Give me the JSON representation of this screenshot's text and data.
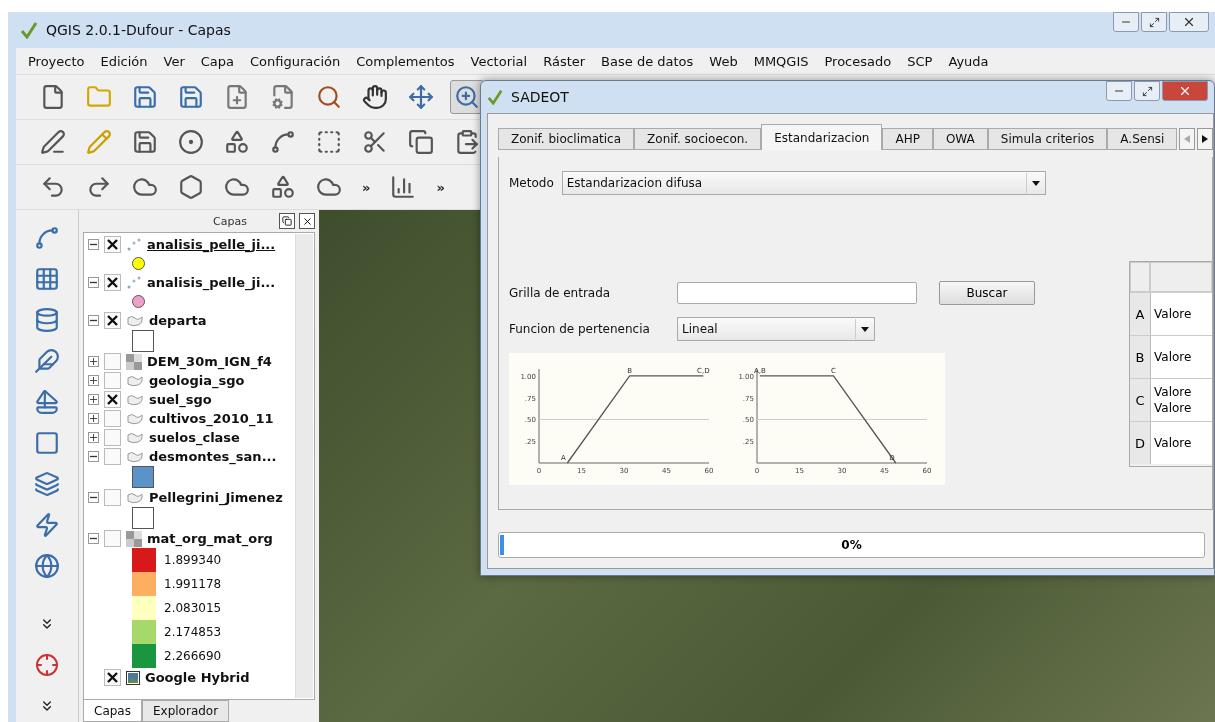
{
  "window": {
    "title": "QGIS 2.0.1-Dufour - Capas"
  },
  "menu": [
    "Proyecto",
    "Edición",
    "Ver",
    "Capa",
    "Configuración",
    "Complementos",
    "Vectorial",
    "Ráster",
    "Base de datos",
    "Web",
    "MMQGIS",
    "Procesado",
    "SCP",
    "Ayuda"
  ],
  "toolbar_overflow": [
    "»",
    "»"
  ],
  "layers_panel": {
    "title": "Capas",
    "layers": [
      {
        "name": "analisis_pelle_ji...",
        "kind": "points",
        "checked": true,
        "expanded": true,
        "selected": true,
        "children": [
          {
            "kind": "circle",
            "color": "#ffff00"
          }
        ]
      },
      {
        "name": "analisis_pelle_ji...",
        "kind": "points",
        "checked": true,
        "expanded": true,
        "selected": false,
        "children": [
          {
            "kind": "circle",
            "color": "#f0a0c8"
          }
        ]
      },
      {
        "name": "departa",
        "kind": "polygon",
        "checked": true,
        "expanded": true,
        "selected": false,
        "children": [
          {
            "kind": "square",
            "color": "#ffffff"
          }
        ]
      },
      {
        "name": "DEM_30m_IGN_f4",
        "kind": "raster",
        "checked": false,
        "expanded": false,
        "selected": false
      },
      {
        "name": "geologia_sgo",
        "kind": "polygon",
        "checked": false,
        "expanded": false,
        "selected": false
      },
      {
        "name": "suel_sgo",
        "kind": "polygon",
        "checked": true,
        "expanded": false,
        "selected": false
      },
      {
        "name": "cultivos_2010_11",
        "kind": "polygon",
        "checked": false,
        "expanded": false,
        "selected": false
      },
      {
        "name": "suelos_clase",
        "kind": "polygon",
        "checked": false,
        "expanded": false,
        "selected": false
      },
      {
        "name": "desmontes_san...",
        "kind": "polygon",
        "checked": false,
        "expanded": true,
        "selected": false,
        "children": [
          {
            "kind": "square",
            "color": "#5b93c9"
          }
        ]
      },
      {
        "name": "Pellegrini_Jimenez",
        "kind": "polygon",
        "checked": false,
        "expanded": true,
        "selected": false,
        "children": [
          {
            "kind": "square",
            "color": "#ffffff"
          }
        ]
      },
      {
        "name": "mat_org_mat_org",
        "kind": "raster",
        "checked": false,
        "expanded": true,
        "selected": false,
        "children": [
          {
            "kind": "class",
            "label": "1.899340",
            "color": "#d7191c"
          },
          {
            "kind": "class",
            "label": "1.991178",
            "color": "#fdae61"
          },
          {
            "kind": "class",
            "label": "2.083015",
            "color": "#ffffbf"
          },
          {
            "kind": "class",
            "label": "2.174853",
            "color": "#a6d96a"
          },
          {
            "kind": "class",
            "label": "2.266690",
            "color": "#1a9641"
          }
        ]
      },
      {
        "name": "Google Hybrid",
        "kind": "image",
        "checked": true,
        "selected": false
      }
    ],
    "tabs": [
      {
        "label": "Capas",
        "selected": true
      },
      {
        "label": "Explorador",
        "selected": false
      }
    ]
  },
  "dialog": {
    "title": "SADEOT",
    "tabs": [
      {
        "label": "Zonif. bioclimatica",
        "selected": false
      },
      {
        "label": "Zonif. socioecon.",
        "selected": false
      },
      {
        "label": "Estandarizacion",
        "selected": true
      },
      {
        "label": "AHP",
        "selected": false
      },
      {
        "label": "OWA",
        "selected": false
      },
      {
        "label": "Simula criterios",
        "selected": false
      },
      {
        "label": "A.Sensi",
        "selected": false
      }
    ],
    "method": {
      "label": "Metodo",
      "value": "Estandarizacion difusa"
    },
    "input_grid": {
      "label": "Grilla de entrada",
      "button": "Buscar"
    },
    "membership": {
      "label": "Funcion de pertenencia",
      "value": "Lineal"
    },
    "charts": [
      {
        "chart_data": {
          "type": "line",
          "x": [
            10,
            32,
            58
          ],
          "series": [
            {
              "color": "#555555",
              "values": [
                0,
                1,
                1
              ]
            }
          ],
          "xlim": [
            0,
            60
          ],
          "ylim": [
            0,
            1.08
          ],
          "xticks": [
            0,
            15,
            30,
            45,
            60
          ],
          "yticks": [
            {
              "value": 0.25,
              "label": ".25"
            },
            {
              "value": 0.5,
              "label": ".50"
            },
            {
              "value": 0.75,
              "label": ".75"
            },
            {
              "value": 1,
              "label": "1.00"
            }
          ],
          "annotations": [
            {
              "x": 10,
              "y": 0,
              "text": "A"
            },
            {
              "x": 32,
              "y": 1,
              "text": "B"
            },
            {
              "x": 58,
              "y": 1,
              "text": "C,D"
            }
          ]
        }
      },
      {
        "chart_data": {
          "type": "line",
          "x": [
            1,
            27,
            49
          ],
          "series": [
            {
              "color": "#555555",
              "values": [
                1,
                1,
                0
              ]
            }
          ],
          "xlim": [
            0,
            60
          ],
          "ylim": [
            0,
            1.08
          ],
          "xticks": [
            0,
            15,
            30,
            45,
            60
          ],
          "yticks": [
            {
              "value": 0.25,
              "label": ".25"
            },
            {
              "value": 0.5,
              "label": ".50"
            },
            {
              "value": 0.75,
              "label": ".75"
            },
            {
              "value": 1,
              "label": "1.00"
            }
          ],
          "annotations": [
            {
              "x": 1,
              "y": 1,
              "text": "A,B"
            },
            {
              "x": 27,
              "y": 1,
              "text": "C"
            },
            {
              "x": 49,
              "y": 0,
              "text": "D"
            }
          ]
        }
      }
    ],
    "table": {
      "rows": [
        {
          "header": "A",
          "lines": [
            "Valore"
          ]
        },
        {
          "header": "B",
          "lines": [
            "Valore"
          ]
        },
        {
          "header": "C",
          "lines": [
            "Valore",
            "Valore"
          ]
        },
        {
          "header": "D",
          "lines": [
            "Valore"
          ]
        }
      ]
    },
    "progress": {
      "level": 0.005,
      "text": "0%"
    }
  }
}
